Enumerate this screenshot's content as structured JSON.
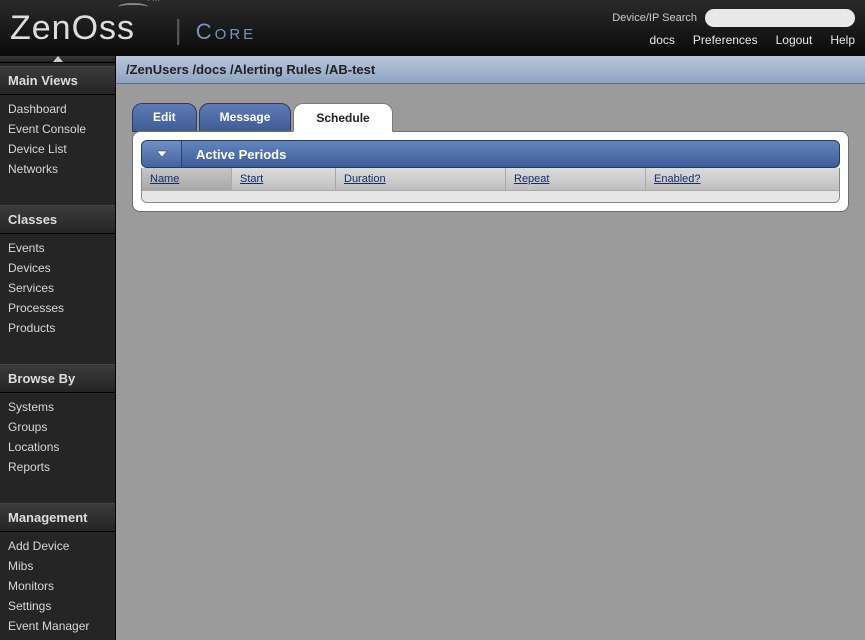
{
  "header": {
    "logo": {
      "brand": "Zen",
      "brand2": "ss",
      "tm": "TM",
      "product": "Core"
    },
    "search_label": "Device/IP Search",
    "search_placeholder": "",
    "links": {
      "docs": "docs",
      "preferences": "Preferences",
      "logout": "Logout",
      "help": "Help"
    }
  },
  "breadcrumb": "/ZenUsers /docs /Alerting Rules /AB-test",
  "sidebar": {
    "sections": [
      {
        "title": "Main Views",
        "items": [
          "Dashboard",
          "Event Console",
          "Device List",
          "Networks"
        ]
      },
      {
        "title": "Classes",
        "items": [
          "Events",
          "Devices",
          "Services",
          "Processes",
          "Products"
        ]
      },
      {
        "title": "Browse By",
        "items": [
          "Systems",
          "Groups",
          "Locations",
          "Reports"
        ]
      },
      {
        "title": "Management",
        "items": [
          "Add Device",
          "Mibs",
          "Monitors",
          "Settings",
          "Event Manager"
        ]
      }
    ]
  },
  "tabs": [
    {
      "label": "Edit",
      "active": false
    },
    {
      "label": "Message",
      "active": false
    },
    {
      "label": "Schedule",
      "active": true
    }
  ],
  "panel": {
    "title": "Active Periods",
    "columns": [
      {
        "label": "Name",
        "key": "name",
        "sorted": true
      },
      {
        "label": "Start",
        "key": "start",
        "sorted": false
      },
      {
        "label": "Duration",
        "key": "duration",
        "sorted": false
      },
      {
        "label": "Repeat",
        "key": "repeat",
        "sorted": false
      },
      {
        "label": "Enabled?",
        "key": "enabled",
        "sorted": false
      }
    ],
    "rows": []
  }
}
